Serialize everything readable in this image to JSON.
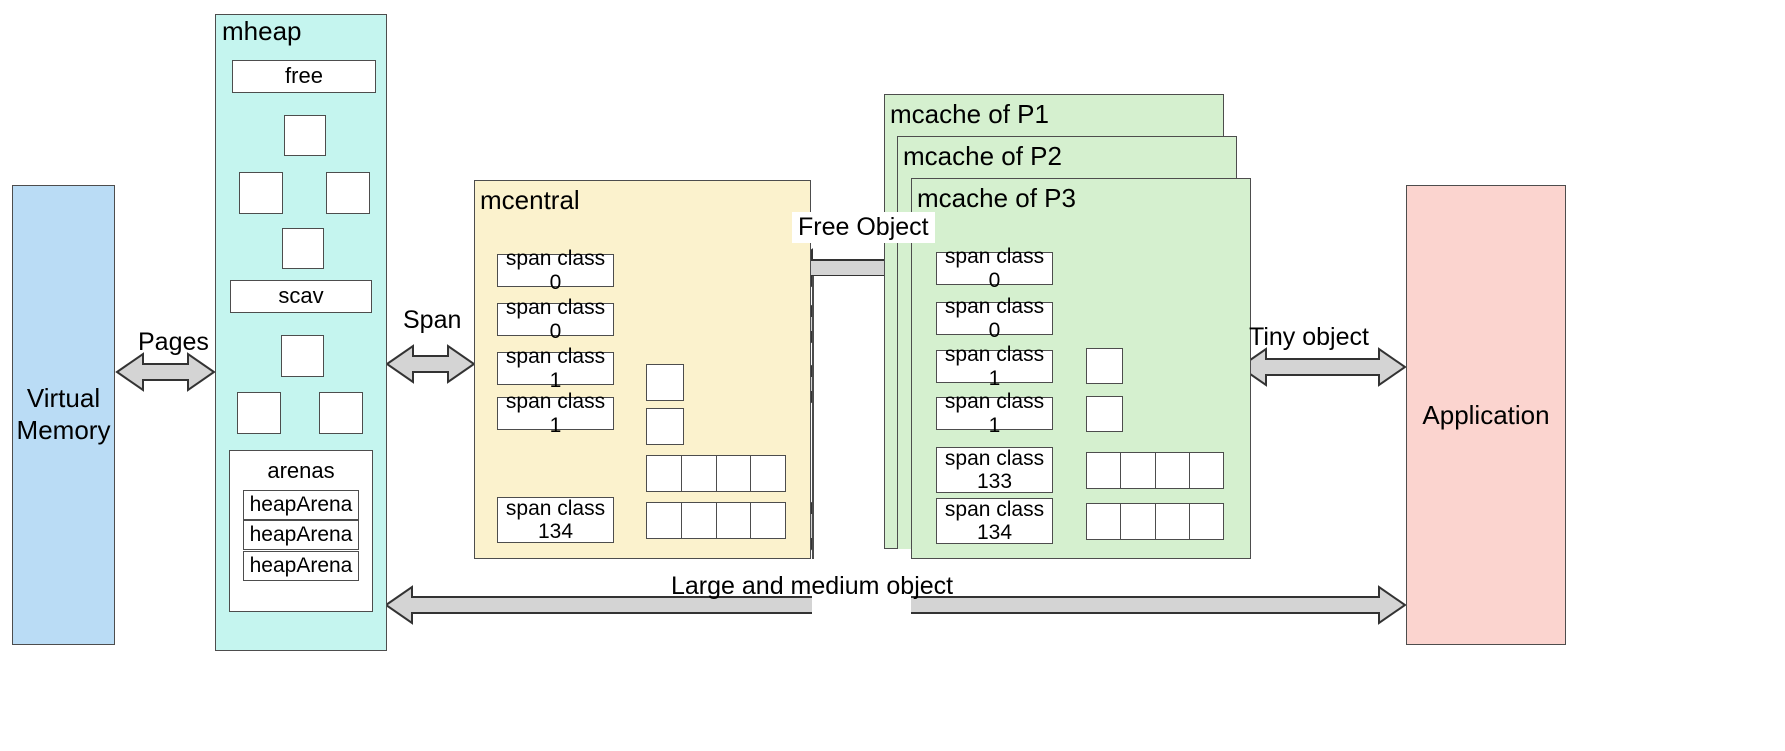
{
  "diagram": {
    "title": "Go memory allocator structure",
    "colors": {
      "virtual_memory": "#badcf5",
      "mheap": "#c5f5ef",
      "mcentral": "#fbf2cd",
      "mcache": "#d5f0cf",
      "application": "#fbd4cf",
      "arrow_fill": "#d4d4d4",
      "stroke": "#4d4d4d"
    }
  },
  "virtual_memory": {
    "label_line1": "Virtual",
    "label_line2": "Memory"
  },
  "mheap": {
    "title": "mheap",
    "free_label": "free",
    "scav_label": "scav",
    "arenas": {
      "title": "arenas",
      "items": [
        "heapArena",
        "heapArena",
        "heapArena"
      ]
    }
  },
  "mcentral": {
    "title": "mcentral",
    "span_classes": [
      "span class 0",
      "span class 0",
      "span class 1",
      "span class 1",
      "span class\n134"
    ],
    "span_class_0_a": "span class 0",
    "span_class_0_b": "span class 0",
    "span_class_1_a": "span class 1",
    "span_class_1_b": "span class 1",
    "span_class_134": "span class\n134"
  },
  "mcache": {
    "cards": [
      {
        "title": "mcache of P1"
      },
      {
        "title": "mcache of P2"
      },
      {
        "title": "mcache of P3"
      }
    ],
    "span_classes": [
      "span class 0",
      "span class 0",
      "span class 1",
      "span class 1",
      "span class\n133",
      "span class\n134"
    ],
    "span_class_0_a": "span class 0",
    "span_class_0_b": "span class 0",
    "span_class_1_a": "span class 1",
    "span_class_1_b": "span class 1",
    "span_class_133": "span class\n133",
    "span_class_134": "span class\n134"
  },
  "application": {
    "label": "Application"
  },
  "edges": {
    "pages": "Pages",
    "span": "Span",
    "free_object": "Free Object",
    "tiny_object": "Tiny object",
    "large_and_medium_object": "Large and medium object"
  }
}
